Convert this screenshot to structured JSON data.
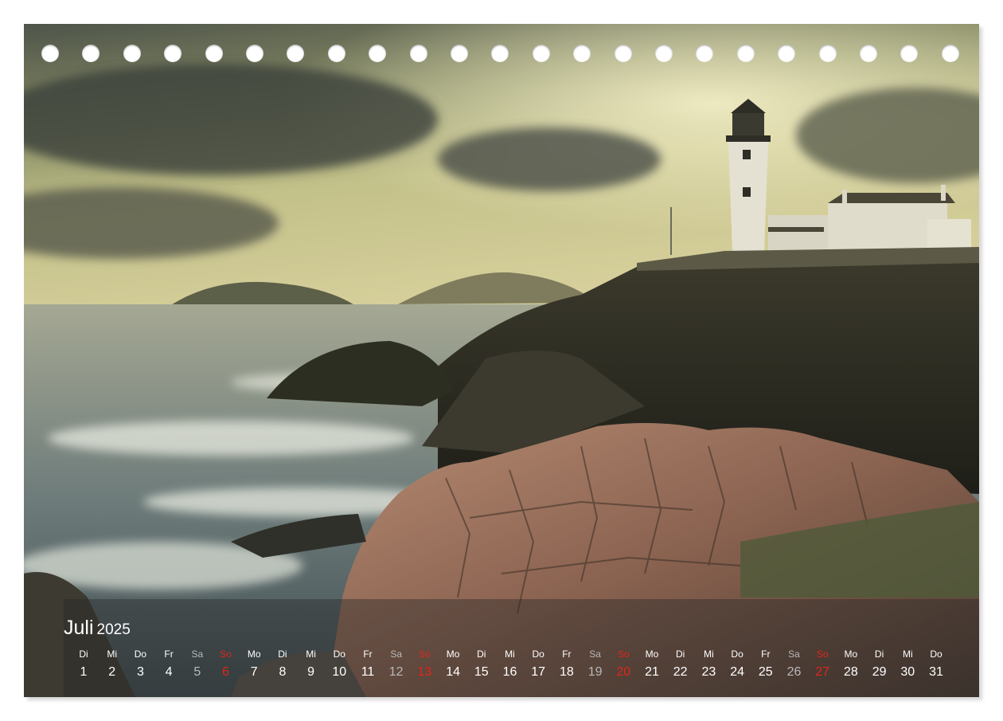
{
  "calendar": {
    "month": "Juli",
    "year": "2025",
    "days": [
      {
        "dow": "Di",
        "num": "1",
        "kind": "weekday"
      },
      {
        "dow": "Mi",
        "num": "2",
        "kind": "weekday"
      },
      {
        "dow": "Do",
        "num": "3",
        "kind": "weekday"
      },
      {
        "dow": "Fr",
        "num": "4",
        "kind": "weekday"
      },
      {
        "dow": "Sa",
        "num": "5",
        "kind": "sat"
      },
      {
        "dow": "So",
        "num": "6",
        "kind": "sun"
      },
      {
        "dow": "Mo",
        "num": "7",
        "kind": "weekday"
      },
      {
        "dow": "Di",
        "num": "8",
        "kind": "weekday"
      },
      {
        "dow": "Mi",
        "num": "9",
        "kind": "weekday"
      },
      {
        "dow": "Do",
        "num": "10",
        "kind": "weekday"
      },
      {
        "dow": "Fr",
        "num": "11",
        "kind": "weekday"
      },
      {
        "dow": "Sa",
        "num": "12",
        "kind": "sat"
      },
      {
        "dow": "So",
        "num": "13",
        "kind": "sun"
      },
      {
        "dow": "Mo",
        "num": "14",
        "kind": "weekday"
      },
      {
        "dow": "Di",
        "num": "15",
        "kind": "weekday"
      },
      {
        "dow": "Mi",
        "num": "16",
        "kind": "weekday"
      },
      {
        "dow": "Do",
        "num": "17",
        "kind": "weekday"
      },
      {
        "dow": "Fr",
        "num": "18",
        "kind": "weekday"
      },
      {
        "dow": "Sa",
        "num": "19",
        "kind": "sat"
      },
      {
        "dow": "So",
        "num": "20",
        "kind": "sun"
      },
      {
        "dow": "Mo",
        "num": "21",
        "kind": "weekday"
      },
      {
        "dow": "Di",
        "num": "22",
        "kind": "weekday"
      },
      {
        "dow": "Mi",
        "num": "23",
        "kind": "weekday"
      },
      {
        "dow": "Do",
        "num": "24",
        "kind": "weekday"
      },
      {
        "dow": "Fr",
        "num": "25",
        "kind": "weekday"
      },
      {
        "dow": "Sa",
        "num": "26",
        "kind": "sat"
      },
      {
        "dow": "So",
        "num": "27",
        "kind": "sun"
      },
      {
        "dow": "Mo",
        "num": "28",
        "kind": "weekday"
      },
      {
        "dow": "Di",
        "num": "29",
        "kind": "weekday"
      },
      {
        "dow": "Mi",
        "num": "30",
        "kind": "weekday"
      },
      {
        "dow": "Do",
        "num": "31",
        "kind": "weekday"
      }
    ]
  },
  "colors": {
    "weekday": "#ffffff",
    "saturday": "#b9b9b9",
    "sunday": "#e0251b"
  }
}
